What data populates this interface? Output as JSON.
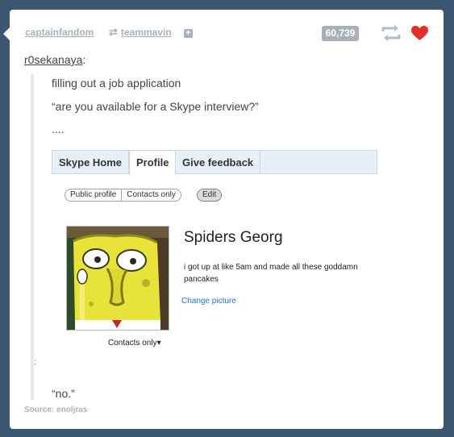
{
  "header": {
    "user1": "captainfandom",
    "user2": "teammavin",
    "reblog_glyph": "⇄",
    "plus": "+",
    "notes_count": "60,739",
    "like_color": "#e0322b"
  },
  "attribution": {
    "user": "r0sekanaya",
    "suffix": ":"
  },
  "quote": {
    "line1": "filling out a job application",
    "line2": "“are you available for a Skype interview?”",
    "line3": "....",
    "final": "“no.”",
    "stray_mark": ":"
  },
  "skype": {
    "tabs": [
      "Skype Home",
      "Profile",
      "Give feedback"
    ],
    "active_tab": "Profile",
    "visibility_options": [
      "Public profile",
      "Contacts only"
    ],
    "edit_label": "Edit",
    "display_name": "Spiders Georg",
    "status": "i got up at like 5am and made all these goddamn pancakes",
    "change_picture": "Change picture",
    "privacy_selected": "Contacts only",
    "privacy_caret": "▾"
  },
  "source": {
    "label": "Source:",
    "name": "enoljras"
  }
}
